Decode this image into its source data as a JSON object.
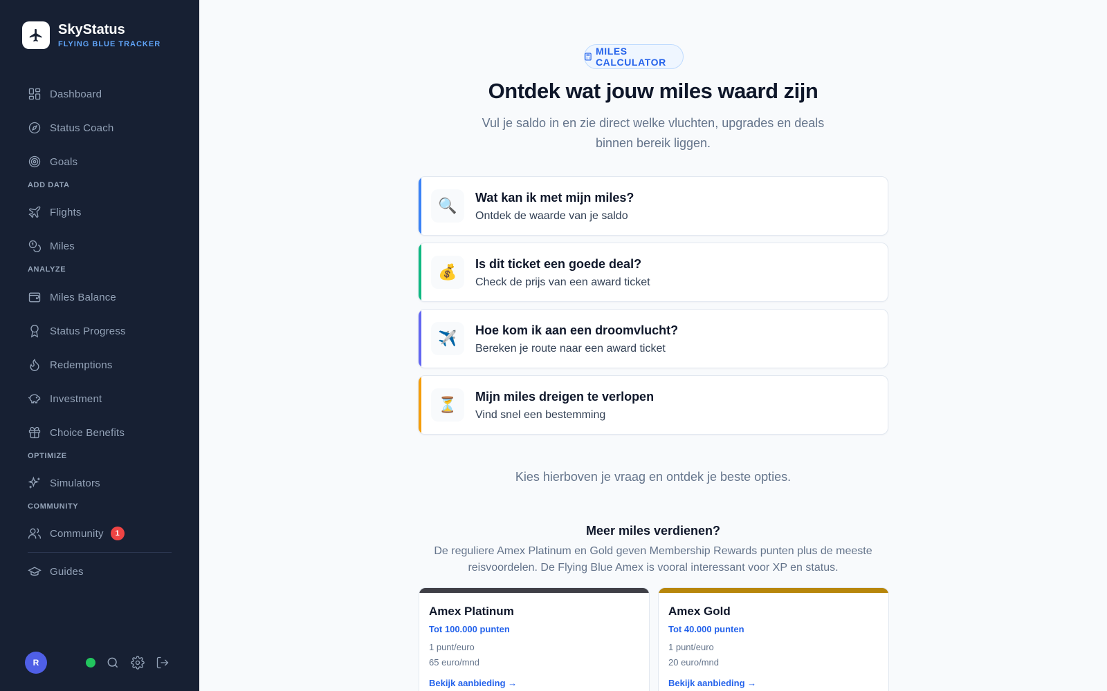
{
  "brand": {
    "name": "SkyStatus",
    "subtitle": "FLYING BLUE TRACKER"
  },
  "sidebar": {
    "sections": {
      "add_data": "ADD DATA",
      "analyze": "ANALYZE",
      "optimize": "OPTIMIZE",
      "community": "COMMUNITY"
    },
    "items": {
      "dashboard": "Dashboard",
      "status_coach": "Status Coach",
      "goals": "Goals",
      "flights": "Flights",
      "miles": "Miles",
      "miles_balance": "Miles Balance",
      "status_progress": "Status Progress",
      "redemptions": "Redemptions",
      "investment": "Investment",
      "choice_benefits": "Choice Benefits",
      "simulators": "Simulators",
      "community": "Community",
      "guides": "Guides"
    },
    "community_badge": "1",
    "user_initial": "R"
  },
  "main": {
    "pill": "MILES CALCULATOR",
    "title": "Ontdek wat jouw miles waard zijn",
    "subtitle": "Vul je saldo in en zie direct welke vluchten, upgrades en deals binnen bereik liggen.",
    "questions": [
      {
        "icon": "🔍",
        "title": "Wat kan ik met mijn miles?",
        "subtitle": "Ontdek de waarde van je saldo",
        "accent": "#3b82f6"
      },
      {
        "icon": "💰",
        "title": "Is dit ticket een goede deal?",
        "subtitle": "Check de prijs van een award ticket",
        "accent": "#10b981"
      },
      {
        "icon": "✈️",
        "title": "Hoe kom ik aan een droomvlucht?",
        "subtitle": "Bereken je route naar een award ticket",
        "accent": "#6366f1"
      },
      {
        "icon": "⏳",
        "title": "Mijn miles dreigen te verlopen",
        "subtitle": "Vind snel een bestemming",
        "accent": "#f59e0b"
      }
    ],
    "hint": "Kies hierboven je vraag en ontdek je beste opties.",
    "earn": {
      "title": "Meer miles verdienen?",
      "description": "De reguliere Amex Platinum en Gold geven Membership Rewards punten plus de meeste reisvoordelen. De Flying Blue Amex is vooral interessant voor XP en status."
    },
    "offers": [
      {
        "name": "Amex Platinum",
        "points": "Tot 100.000 punten",
        "rate": "1 punt/euro",
        "fee": "65 euro/mnd",
        "link": "Bekijk aanbieding →",
        "color": "#3f3f46"
      },
      {
        "name": "Amex Gold",
        "points": "Tot 40.000 punten",
        "rate": "1 punt/euro",
        "fee": "20 euro/mnd",
        "link": "Bekijk aanbieding →",
        "color": "#b7860b"
      }
    ]
  }
}
